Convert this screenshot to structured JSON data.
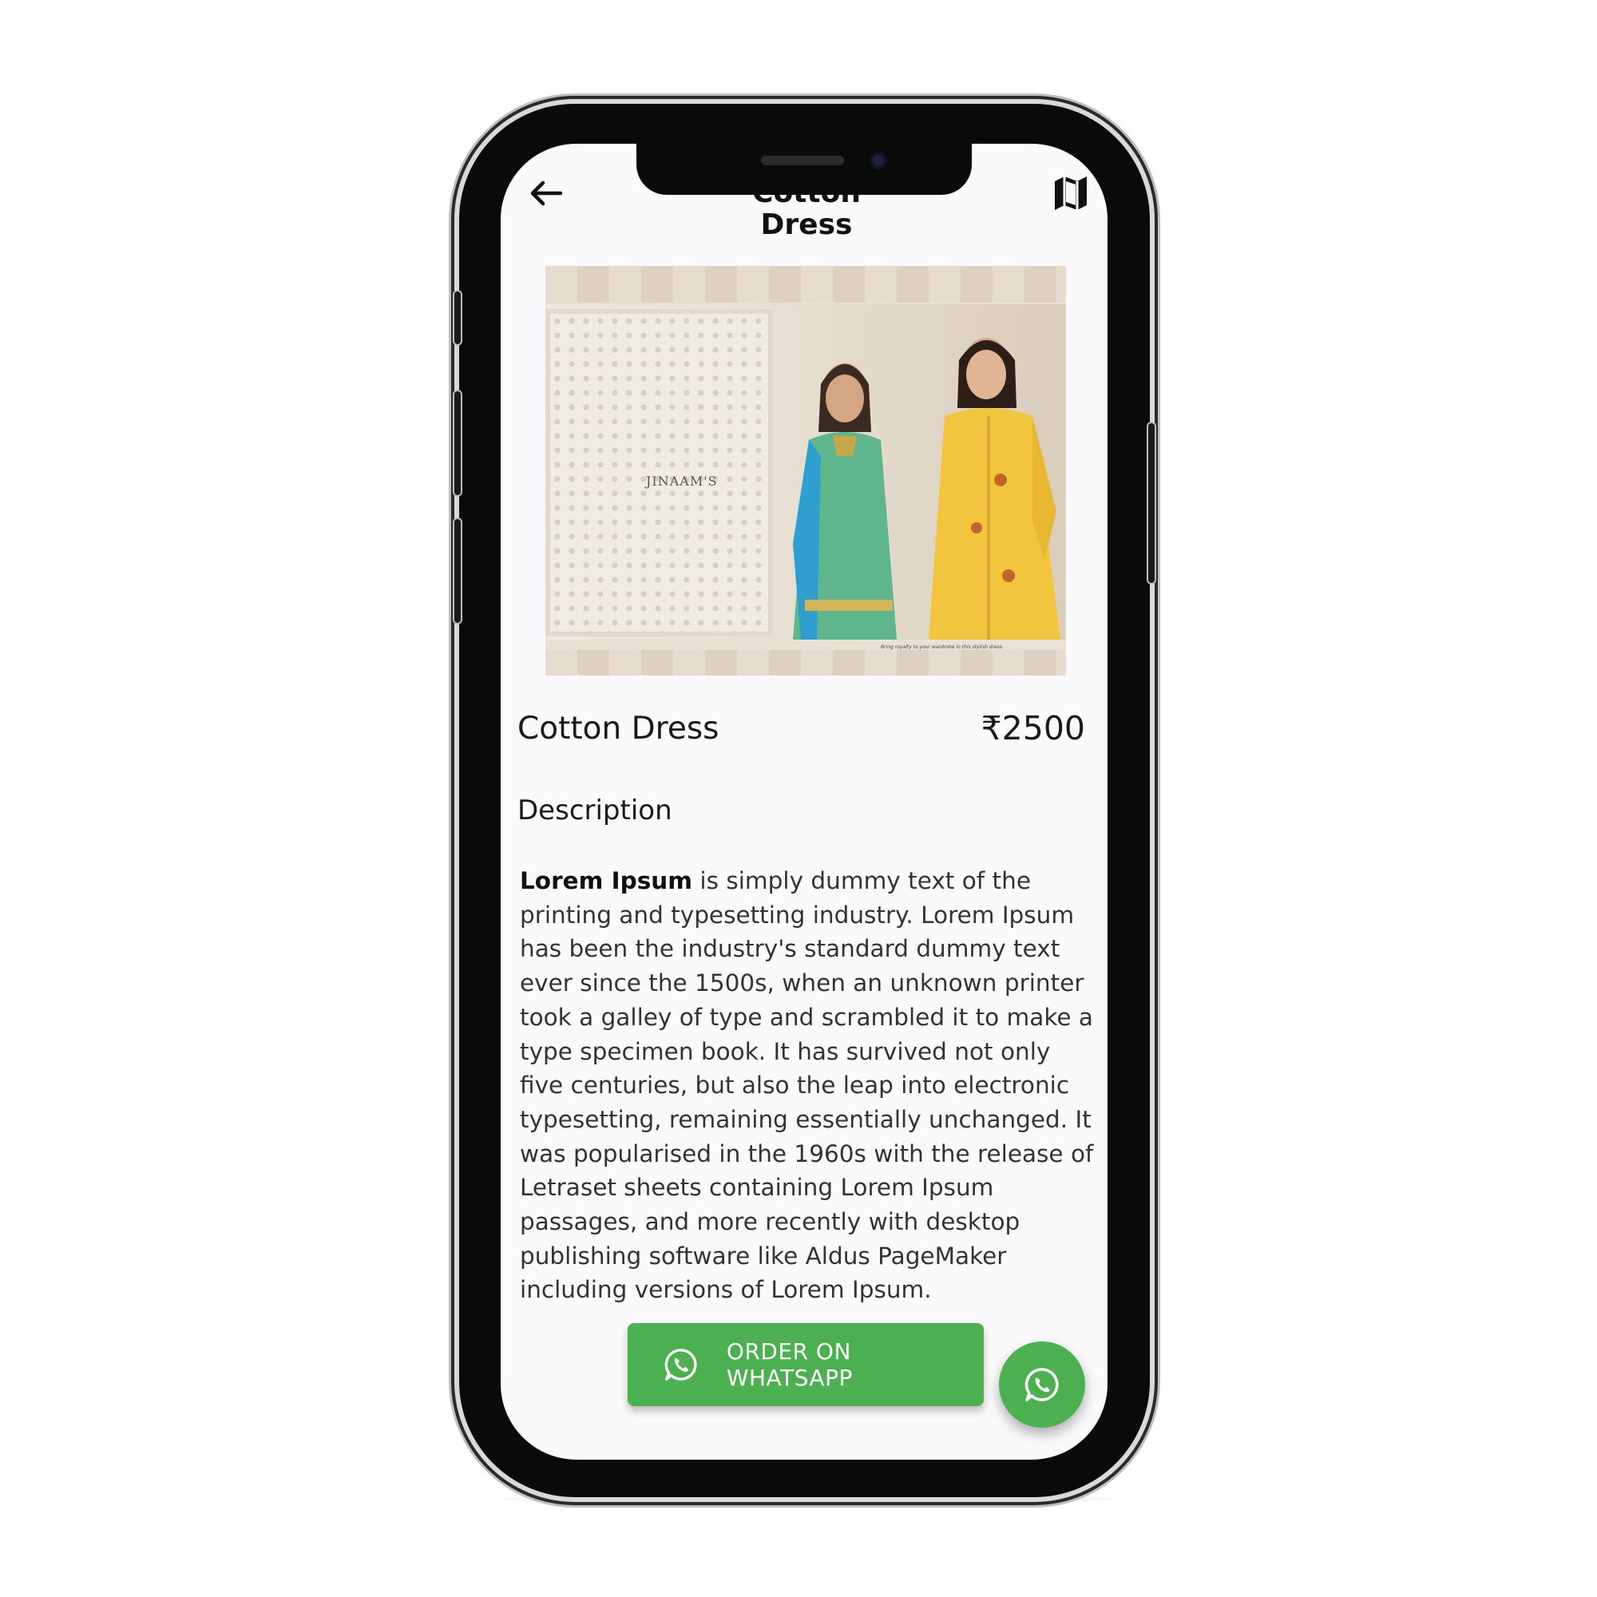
{
  "header": {
    "title": "Cotton Dress",
    "back_icon": "arrow-left-icon",
    "map_icon": "map-icon"
  },
  "product": {
    "image_logo": "JINAAM'S",
    "image_caption": "Bring royalty to your wardrobe in this stylish dress",
    "name": "Cotton Dress",
    "price": "₹2500"
  },
  "description": {
    "heading": "Description",
    "lead": "Lorem Ipsum",
    "body": " is simply dummy text of the printing and typesetting industry. Lorem Ipsum has been the industry's standard dummy text ever since the 1500s, when an unknown printer took a galley of type and scrambled it to make a type specimen book. It has survived not only five centuries, but also the leap into electronic typesetting, remaining essentially unchanged. It was popularised in the 1960s with the release of Letraset sheets containing Lorem Ipsum passages, and more recently with desktop publishing software like Aldus PageMaker including versions of Lorem Ipsum."
  },
  "actions": {
    "order_label": "ORDER ON WHATSAPP",
    "order_icon": "whatsapp-icon",
    "fab_icon": "whatsapp-icon"
  },
  "colors": {
    "accent": "#4caf50",
    "screen_bg": "#fafafc",
    "text": "#1a1a1a"
  }
}
